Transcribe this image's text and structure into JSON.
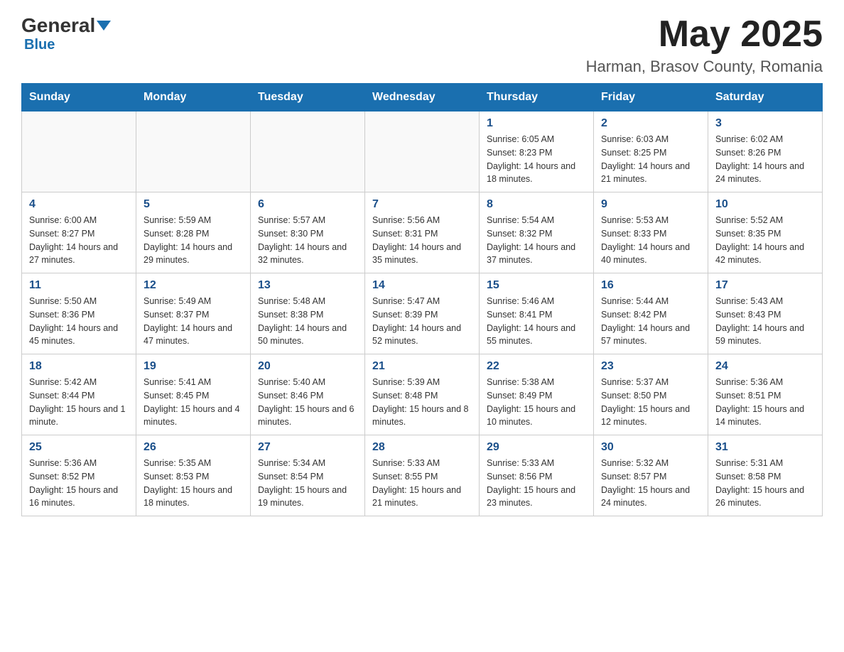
{
  "header": {
    "logo_general": "General",
    "logo_blue": "Blue",
    "month_title": "May 2025",
    "location": "Harman, Brasov County, Romania"
  },
  "weekdays": [
    "Sunday",
    "Monday",
    "Tuesday",
    "Wednesday",
    "Thursday",
    "Friday",
    "Saturday"
  ],
  "weeks": [
    [
      {
        "day": "",
        "info": ""
      },
      {
        "day": "",
        "info": ""
      },
      {
        "day": "",
        "info": ""
      },
      {
        "day": "",
        "info": ""
      },
      {
        "day": "1",
        "info": "Sunrise: 6:05 AM\nSunset: 8:23 PM\nDaylight: 14 hours and 18 minutes."
      },
      {
        "day": "2",
        "info": "Sunrise: 6:03 AM\nSunset: 8:25 PM\nDaylight: 14 hours and 21 minutes."
      },
      {
        "day": "3",
        "info": "Sunrise: 6:02 AM\nSunset: 8:26 PM\nDaylight: 14 hours and 24 minutes."
      }
    ],
    [
      {
        "day": "4",
        "info": "Sunrise: 6:00 AM\nSunset: 8:27 PM\nDaylight: 14 hours and 27 minutes."
      },
      {
        "day": "5",
        "info": "Sunrise: 5:59 AM\nSunset: 8:28 PM\nDaylight: 14 hours and 29 minutes."
      },
      {
        "day": "6",
        "info": "Sunrise: 5:57 AM\nSunset: 8:30 PM\nDaylight: 14 hours and 32 minutes."
      },
      {
        "day": "7",
        "info": "Sunrise: 5:56 AM\nSunset: 8:31 PM\nDaylight: 14 hours and 35 minutes."
      },
      {
        "day": "8",
        "info": "Sunrise: 5:54 AM\nSunset: 8:32 PM\nDaylight: 14 hours and 37 minutes."
      },
      {
        "day": "9",
        "info": "Sunrise: 5:53 AM\nSunset: 8:33 PM\nDaylight: 14 hours and 40 minutes."
      },
      {
        "day": "10",
        "info": "Sunrise: 5:52 AM\nSunset: 8:35 PM\nDaylight: 14 hours and 42 minutes."
      }
    ],
    [
      {
        "day": "11",
        "info": "Sunrise: 5:50 AM\nSunset: 8:36 PM\nDaylight: 14 hours and 45 minutes."
      },
      {
        "day": "12",
        "info": "Sunrise: 5:49 AM\nSunset: 8:37 PM\nDaylight: 14 hours and 47 minutes."
      },
      {
        "day": "13",
        "info": "Sunrise: 5:48 AM\nSunset: 8:38 PM\nDaylight: 14 hours and 50 minutes."
      },
      {
        "day": "14",
        "info": "Sunrise: 5:47 AM\nSunset: 8:39 PM\nDaylight: 14 hours and 52 minutes."
      },
      {
        "day": "15",
        "info": "Sunrise: 5:46 AM\nSunset: 8:41 PM\nDaylight: 14 hours and 55 minutes."
      },
      {
        "day": "16",
        "info": "Sunrise: 5:44 AM\nSunset: 8:42 PM\nDaylight: 14 hours and 57 minutes."
      },
      {
        "day": "17",
        "info": "Sunrise: 5:43 AM\nSunset: 8:43 PM\nDaylight: 14 hours and 59 minutes."
      }
    ],
    [
      {
        "day": "18",
        "info": "Sunrise: 5:42 AM\nSunset: 8:44 PM\nDaylight: 15 hours and 1 minute."
      },
      {
        "day": "19",
        "info": "Sunrise: 5:41 AM\nSunset: 8:45 PM\nDaylight: 15 hours and 4 minutes."
      },
      {
        "day": "20",
        "info": "Sunrise: 5:40 AM\nSunset: 8:46 PM\nDaylight: 15 hours and 6 minutes."
      },
      {
        "day": "21",
        "info": "Sunrise: 5:39 AM\nSunset: 8:48 PM\nDaylight: 15 hours and 8 minutes."
      },
      {
        "day": "22",
        "info": "Sunrise: 5:38 AM\nSunset: 8:49 PM\nDaylight: 15 hours and 10 minutes."
      },
      {
        "day": "23",
        "info": "Sunrise: 5:37 AM\nSunset: 8:50 PM\nDaylight: 15 hours and 12 minutes."
      },
      {
        "day": "24",
        "info": "Sunrise: 5:36 AM\nSunset: 8:51 PM\nDaylight: 15 hours and 14 minutes."
      }
    ],
    [
      {
        "day": "25",
        "info": "Sunrise: 5:36 AM\nSunset: 8:52 PM\nDaylight: 15 hours and 16 minutes."
      },
      {
        "day": "26",
        "info": "Sunrise: 5:35 AM\nSunset: 8:53 PM\nDaylight: 15 hours and 18 minutes."
      },
      {
        "day": "27",
        "info": "Sunrise: 5:34 AM\nSunset: 8:54 PM\nDaylight: 15 hours and 19 minutes."
      },
      {
        "day": "28",
        "info": "Sunrise: 5:33 AM\nSunset: 8:55 PM\nDaylight: 15 hours and 21 minutes."
      },
      {
        "day": "29",
        "info": "Sunrise: 5:33 AM\nSunset: 8:56 PM\nDaylight: 15 hours and 23 minutes."
      },
      {
        "day": "30",
        "info": "Sunrise: 5:32 AM\nSunset: 8:57 PM\nDaylight: 15 hours and 24 minutes."
      },
      {
        "day": "31",
        "info": "Sunrise: 5:31 AM\nSunset: 8:58 PM\nDaylight: 15 hours and 26 minutes."
      }
    ]
  ]
}
